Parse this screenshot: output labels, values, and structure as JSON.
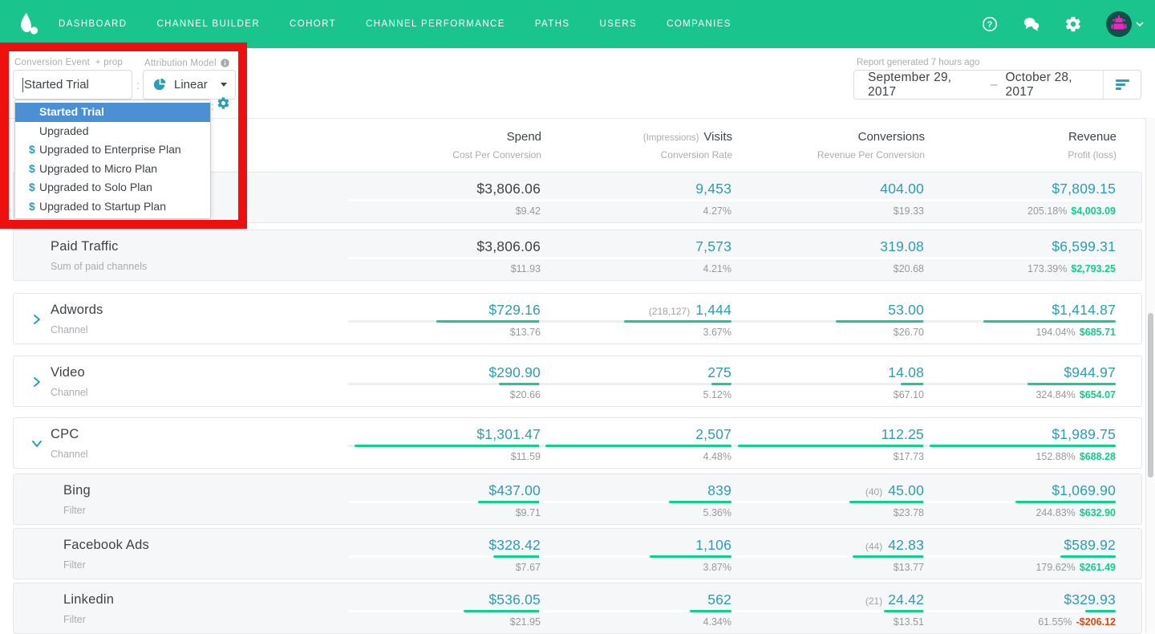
{
  "colors": {
    "nav_green": "#19C48D",
    "accent_teal": "#2B9DB4",
    "bar_green": "#15CD90",
    "profit_green": "#12CB8E",
    "loss_red": "#D8490F",
    "selection_blue": "#4A90D2",
    "annotation_red": "#EE0F0F"
  },
  "nav": {
    "items": [
      {
        "label": "DASHBOARD"
      },
      {
        "label": "CHANNEL BUILDER"
      },
      {
        "label": "COHORT"
      },
      {
        "label": "CHANNEL PERFORMANCE"
      },
      {
        "label": "PATHS"
      },
      {
        "label": "USERS"
      },
      {
        "label": "COMPANIES"
      }
    ],
    "right_icons": [
      "help-icon",
      "messages-icon",
      "settings-icon",
      "avatar",
      "caret-down-icon"
    ]
  },
  "toolbar": {
    "conversion_event_label": "Conversion Event",
    "conversion_event_addon": "+ prop",
    "conversion_event_value": "Started Trial",
    "separator": ":",
    "attribution_model_label": "Attribution Model",
    "attribution_model_value": "Linear",
    "report_generated": "Report generated 7 hours ago",
    "date_start": "September 29, 2017",
    "date_separator": "–",
    "date_end": "October 28, 2017"
  },
  "dropdown": {
    "money_symbol": "$",
    "items": [
      {
        "label": "Started Trial",
        "selected": true,
        "money": false
      },
      {
        "label": "Upgraded",
        "selected": false,
        "money": false
      },
      {
        "label": "Upgraded to Enterprise Plan",
        "selected": false,
        "money": true
      },
      {
        "label": "Upgraded to Micro Plan",
        "selected": false,
        "money": true
      },
      {
        "label": "Upgraded to Solo Plan",
        "selected": false,
        "money": true
      },
      {
        "label": "Upgraded to Startup Plan",
        "selected": false,
        "money": true
      }
    ]
  },
  "table": {
    "columns": [
      {
        "title": "Spend",
        "subtitle": "Cost Per Conversion"
      },
      {
        "prefix": "(Impressions)",
        "title": "Visits",
        "subtitle": "Conversion Rate"
      },
      {
        "title": "Conversions",
        "subtitle": "Revenue Per Conversion"
      },
      {
        "title": "Revenue",
        "subtitle": "Profit (loss)"
      }
    ],
    "rows": [
      {
        "name": "",
        "subtitle": "",
        "shaded": true,
        "indent": false,
        "chevron": null,
        "bars": false,
        "cells": [
          {
            "value": "$3,806.06",
            "sub": "$9.42",
            "dark": true
          },
          {
            "value": "9,453",
            "sub": "4.27%"
          },
          {
            "value": "404.00",
            "sub": "$19.33"
          },
          {
            "value": "$7,809.15",
            "sub": "205.18%",
            "profit": "$4,003.09",
            "loss": false
          }
        ]
      },
      {
        "name": "Paid Traffic",
        "subtitle": "Sum of paid channels",
        "shaded": true,
        "indent": false,
        "chevron": null,
        "bars": false,
        "cells": [
          {
            "value": "$3,806.06",
            "sub": "$11.93",
            "dark": true
          },
          {
            "value": "7,573",
            "sub": "4.21%"
          },
          {
            "value": "319.08",
            "sub": "$20.68"
          },
          {
            "value": "$6,599.31",
            "sub": "173.39%",
            "profit": "$2,793.25",
            "loss": false
          }
        ]
      },
      {
        "name": "Adwords",
        "subtitle": "Channel",
        "shaded": false,
        "indent": false,
        "chevron": "right",
        "bars": true,
        "cells": [
          {
            "value": "$729.16",
            "sub": "$13.76"
          },
          {
            "pre": "(218,127)",
            "value": "1,444",
            "sub": "3.67%"
          },
          {
            "value": "53.00",
            "sub": "$26.70"
          },
          {
            "value": "$1,414.87",
            "sub": "194.04%",
            "profit": "$685.71",
            "loss": false
          }
        ]
      },
      {
        "name": "Video",
        "subtitle": "Channel",
        "shaded": false,
        "indent": false,
        "chevron": "right",
        "bars": true,
        "cells": [
          {
            "value": "$290.90",
            "sub": "$20.66"
          },
          {
            "value": "275",
            "sub": "5.12%"
          },
          {
            "value": "14.08",
            "sub": "$67.10"
          },
          {
            "value": "$944.97",
            "sub": "324.84%",
            "profit": "$654.07",
            "loss": false
          }
        ]
      },
      {
        "name": "CPC",
        "subtitle": "Channel",
        "shaded": false,
        "indent": false,
        "chevron": "down",
        "bars": true,
        "cells": [
          {
            "value": "$1,301.47",
            "sub": "$11.59"
          },
          {
            "value": "2,507",
            "sub": "4.48%"
          },
          {
            "value": "112.25",
            "sub": "$17.73"
          },
          {
            "value": "$1,989.75",
            "sub": "152.88%",
            "profit": "$688.28",
            "loss": false
          }
        ]
      },
      {
        "name": "Bing",
        "subtitle": "Filter",
        "shaded": true,
        "indent": true,
        "chevron": null,
        "bars": true,
        "cells": [
          {
            "value": "$437.00",
            "sub": "$9.71"
          },
          {
            "value": "839",
            "sub": "5.36%"
          },
          {
            "pre": "(40)",
            "value": "45.00",
            "sub": "$23.78"
          },
          {
            "value": "$1,069.90",
            "sub": "244.83%",
            "profit": "$632.90",
            "loss": false
          }
        ]
      },
      {
        "name": "Facebook Ads",
        "subtitle": "Filter",
        "shaded": true,
        "indent": true,
        "chevron": null,
        "bars": true,
        "cells": [
          {
            "value": "$328.42",
            "sub": "$7.67"
          },
          {
            "value": "1,106",
            "sub": "3.87%"
          },
          {
            "pre": "(44)",
            "value": "42.83",
            "sub": "$13.77"
          },
          {
            "value": "$589.92",
            "sub": "179.62%",
            "profit": "$261.49",
            "loss": false
          }
        ]
      },
      {
        "name": "Linkedin",
        "subtitle": "Filter",
        "shaded": true,
        "indent": true,
        "chevron": null,
        "bars": true,
        "cells": [
          {
            "value": "$536.05",
            "sub": "$21.95"
          },
          {
            "value": "562",
            "sub": "4.34%"
          },
          {
            "pre": "(21)",
            "value": "24.42",
            "sub": "$13.51"
          },
          {
            "value": "$329.93",
            "sub": "61.55%",
            "profit": "-$206.12",
            "loss": true
          }
        ]
      }
    ]
  }
}
